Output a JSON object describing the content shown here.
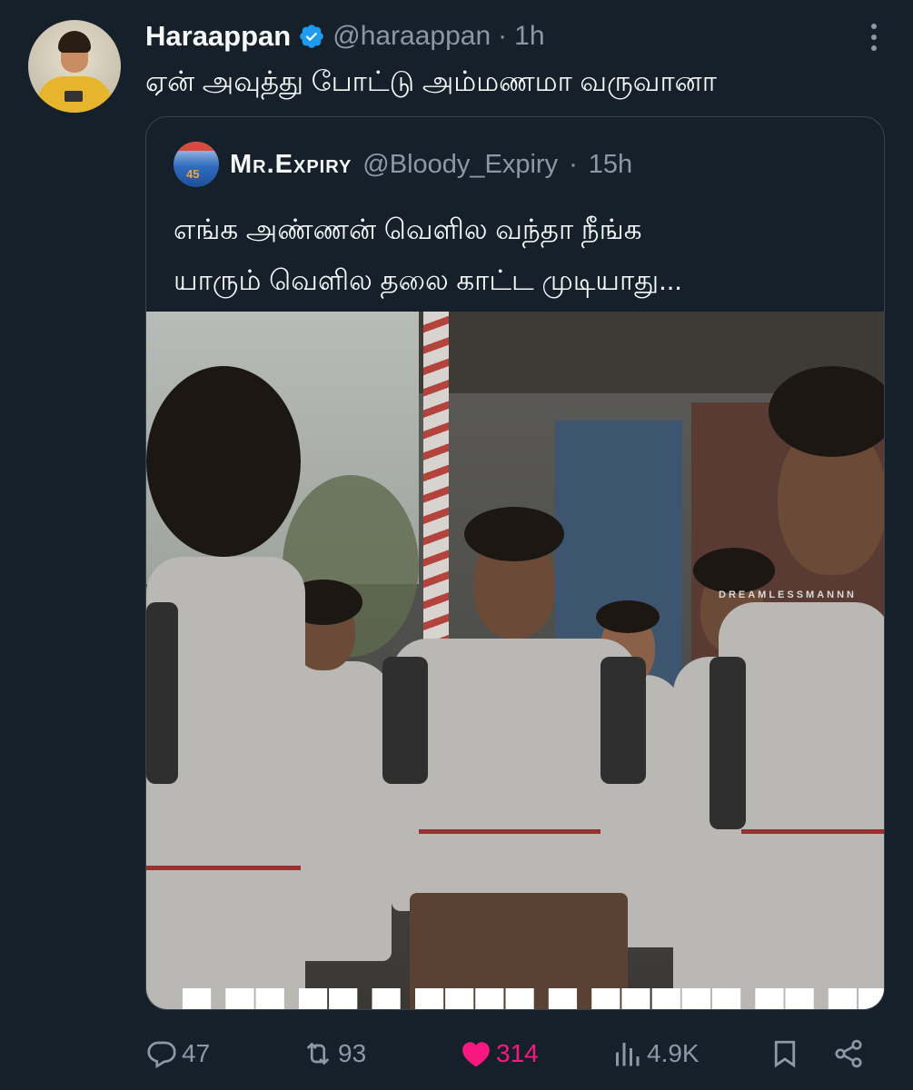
{
  "tweet": {
    "author_name": "Haraappan",
    "author_handle": "@haraappan",
    "separator": "·",
    "time": "1h",
    "text": "ஏன் அவுத்து போட்டு அம்மணமா வருவானா"
  },
  "quoted": {
    "author_name": "Mr.Expiry",
    "author_handle": "@Bloody_Expiry",
    "separator": "·",
    "time": "15h",
    "avatar_number": "45",
    "text_lines": [
      "எங்க அண்ணன் வெளில வந்தா நீங்க",
      "யாரும் வெளில தலை காட்ட முடியாது..."
    ],
    "media": {
      "watermark": "DREAMLESSMANNN",
      "caption_partial": "▀ ▀▀ ▀▀ ▀ ▀▀▀▀  ▀ ▀▀▀▀▀ ▀▀ ▀▀ ▀▀"
    }
  },
  "actions": {
    "replies": "47",
    "retweets": "93",
    "likes": "314",
    "views": "4.9K"
  },
  "colors": {
    "background": "#15202b",
    "secondary_text": "#8b98a5",
    "like_pink": "#f91880",
    "verified_blue": "#1d9bf0"
  }
}
